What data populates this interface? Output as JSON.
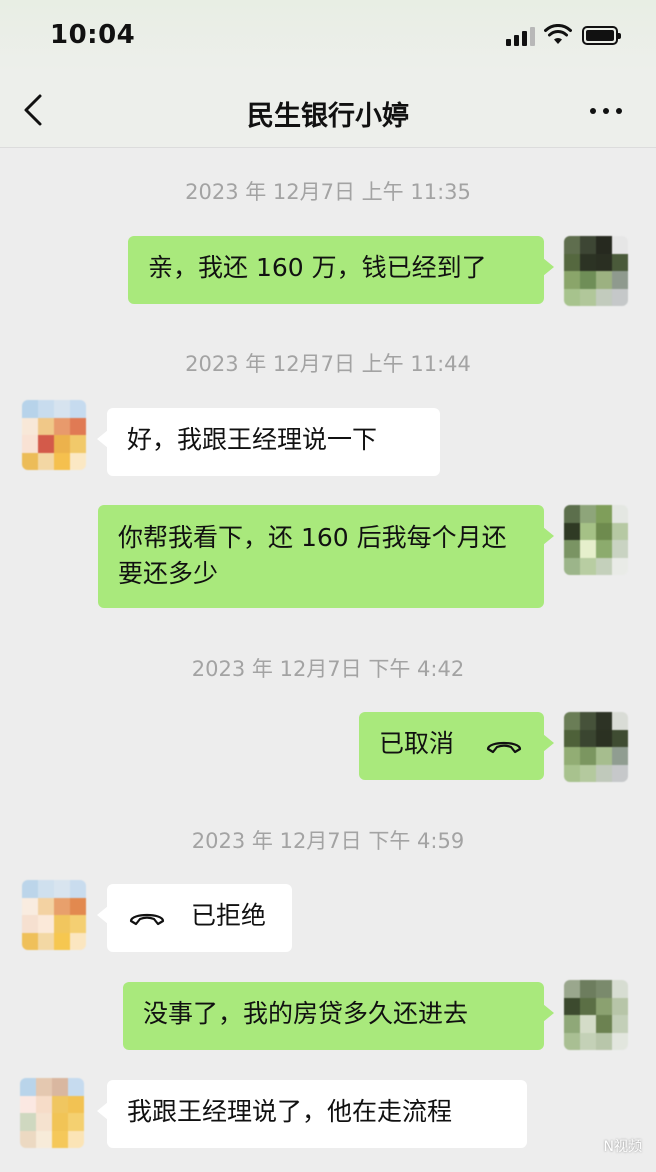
{
  "status_bar": {
    "time": "10:04"
  },
  "header": {
    "title": "民生银行小婷"
  },
  "messages": [
    {
      "type": "time",
      "text": "2023 年 12月7日 上午 11:35"
    },
    {
      "type": "outgoing",
      "text": "亲，我还 160 万，钱已经到了"
    },
    {
      "type": "time",
      "text": "2023 年 12月7日 上午 11:44"
    },
    {
      "type": "incoming",
      "text": "好，我跟王经理说一下"
    },
    {
      "type": "outgoing",
      "text": "你帮我看下，还 160 后我每个月还要还多少"
    },
    {
      "type": "time",
      "text": "2023 年 12月7日 下午 4:42"
    },
    {
      "type": "outgoing_call",
      "text": "已取消",
      "icon": "phone-hangup-icon"
    },
    {
      "type": "time",
      "text": "2023 年 12月7日 下午 4:59"
    },
    {
      "type": "incoming_call",
      "text": "已拒绝",
      "icon": "phone-hangup-icon"
    },
    {
      "type": "outgoing",
      "text": "没事了，我的房贷多久还进去"
    },
    {
      "type": "incoming",
      "text": "我跟王经理说了，他在走流程"
    }
  ],
  "watermark": "N视频",
  "colors": {
    "outgoing_bubble": "#a9e97c",
    "incoming_bubble": "#ffffff",
    "background": "#ededed",
    "timestamp": "#a3a3a3"
  }
}
